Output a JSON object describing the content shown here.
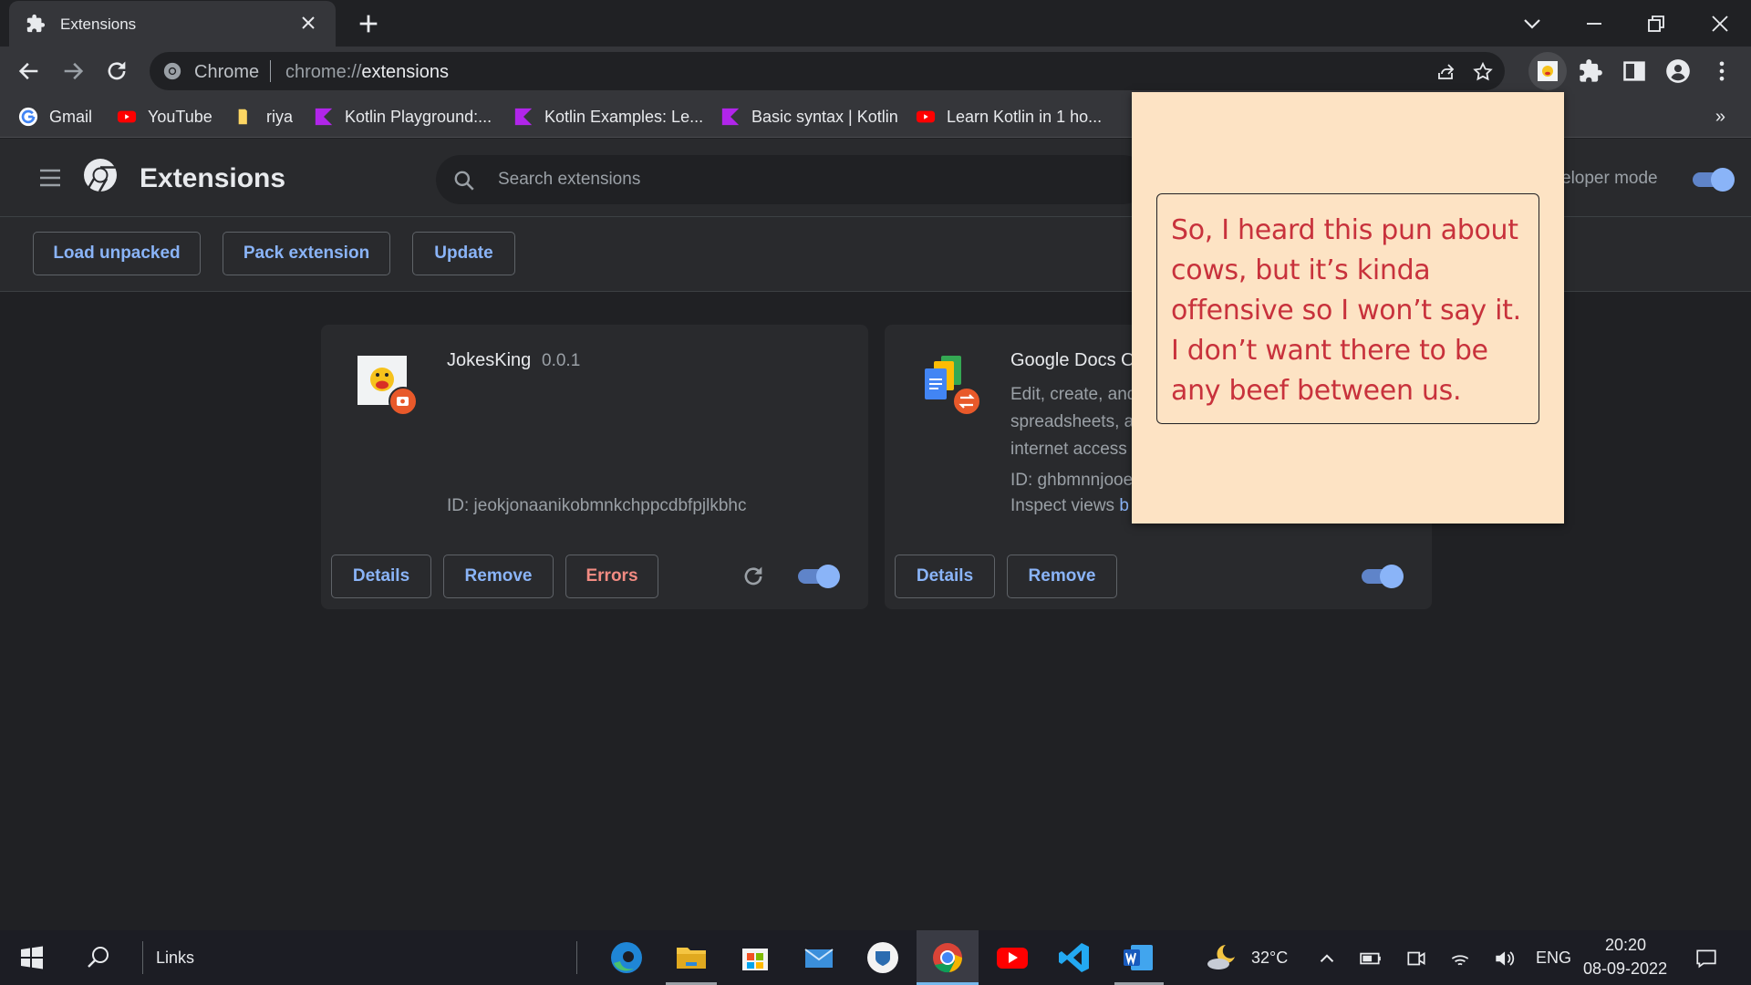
{
  "tab": {
    "title": "Extensions"
  },
  "omnibox": {
    "site": "Chrome",
    "url_scheme": "chrome://",
    "url_host": "extensions"
  },
  "bookmarks": [
    {
      "label": "Gmail",
      "icon": "google-icon"
    },
    {
      "label": "YouTube",
      "icon": "youtube-icon"
    },
    {
      "label": "riya",
      "icon": "folder-icon"
    },
    {
      "label": "Kotlin Playground:...",
      "icon": "kotlin-icon"
    },
    {
      "label": "Kotlin Examples: Le...",
      "icon": "kotlin-icon"
    },
    {
      "label": "Basic syntax | Kotlin",
      "icon": "kotlin-icon"
    },
    {
      "label": "Learn Kotlin in 1 ho...",
      "icon": "youtube-icon"
    }
  ],
  "bookmarks_more": "»",
  "header": {
    "title": "Extensions",
    "search_placeholder": "Search extensions",
    "devmode_label": "eloper mode",
    "devmode_on": true
  },
  "subbar": {
    "load_unpacked": "Load unpacked",
    "pack_extension": "Pack extension",
    "update": "Update"
  },
  "extensions": [
    {
      "name": "JokesKing",
      "version": "0.0.1",
      "id_line": "ID: jeokjonaanikobmnkchppcdbfpjlkbhc",
      "details": "Details",
      "remove": "Remove",
      "errors": "Errors",
      "enabled": true
    },
    {
      "name": "Google Docs Of",
      "desc_lines": [
        "Edit, create, and",
        "spreadsheets, a",
        "internet access"
      ],
      "id_line": "ID: ghbmnnjooe",
      "inspect_prefix": "Inspect views ",
      "inspect_link": "b",
      "details": "Details",
      "remove": "Remove",
      "enabled": true
    }
  ],
  "popup": {
    "joke": "So, I heard this pun about cows, but it’s kinda offensive so I won’t say it. I don’t want there to be any beef between us."
  },
  "taskbar": {
    "links_label": "Links",
    "weather": "32°C",
    "lang": "ENG",
    "time": "20:20",
    "date": "08-09-2022"
  },
  "colors": {
    "accent": "#8ab4f8",
    "error": "#f28b82",
    "popup_bg": "#fde3c4",
    "joke_text": "#c8323c"
  }
}
